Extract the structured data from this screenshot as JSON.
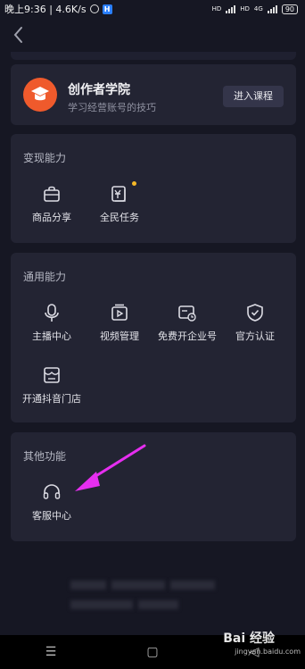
{
  "status_bar": {
    "time_speed": "晚上9:36 | 4.6K/s",
    "network1": "4G",
    "network2": "4G",
    "hd1": "HD",
    "hd2": "HD",
    "battery": "90"
  },
  "academy": {
    "title": "创作者学院",
    "subtitle": "学习经营账号的技巧",
    "button": "进入课程",
    "logo_color": "#ef5a2c"
  },
  "sections": {
    "monetize": {
      "title": "变现能力",
      "items": [
        {
          "label": "商品分享",
          "icon": "shopping-bag-icon"
        },
        {
          "label": "全民任务",
          "icon": "task-yuan-icon",
          "badge_color": "#f5b827"
        }
      ]
    },
    "general": {
      "title": "通用能力",
      "items": [
        {
          "label": "主播中心",
          "icon": "microphone-icon"
        },
        {
          "label": "视频管理",
          "icon": "video-manage-icon"
        },
        {
          "label": "免费开企业号",
          "icon": "enterprise-card-icon"
        },
        {
          "label": "官方认证",
          "icon": "shield-check-icon"
        },
        {
          "label": "开通抖音门店",
          "icon": "store-icon"
        }
      ]
    },
    "other": {
      "title": "其他功能",
      "items": [
        {
          "label": "客服中心",
          "icon": "headset-icon"
        }
      ]
    }
  },
  "annotation": {
    "arrow_color": "#e62ef0"
  },
  "watermark": {
    "brand": "Bai 经验",
    "url": "jingyan.baidu.com"
  }
}
